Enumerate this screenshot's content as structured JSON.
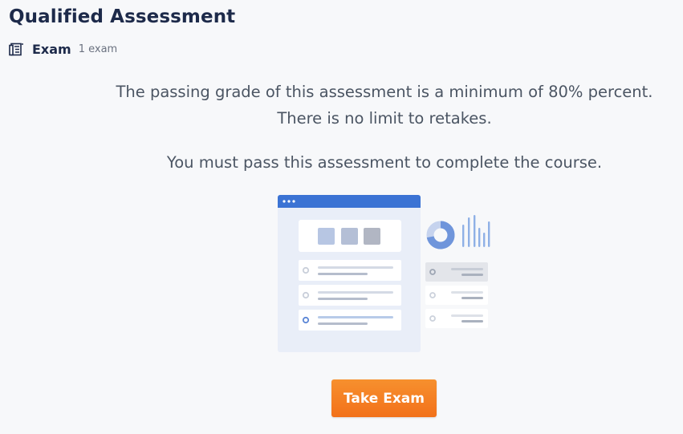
{
  "page": {
    "title": "Qualified Assessment",
    "section_icon": "exam-document-icon",
    "section_label": "Exam",
    "section_count": "1 exam"
  },
  "message": {
    "line1": "The passing grade of this assessment is a minimum of 80% percent.",
    "line2": "There is no limit to retakes.",
    "line3": "You must pass this assessment to complete the course."
  },
  "illustration": {
    "icon": "exam-dashboard-illustration",
    "accent": "#3b73d4"
  },
  "actions": {
    "take_exam_label": "Take Exam",
    "button_color": "#f47b20"
  },
  "colors": {
    "background": "#f7f8fa",
    "heading": "#1d2a4a",
    "body_text": "#4b5563"
  }
}
